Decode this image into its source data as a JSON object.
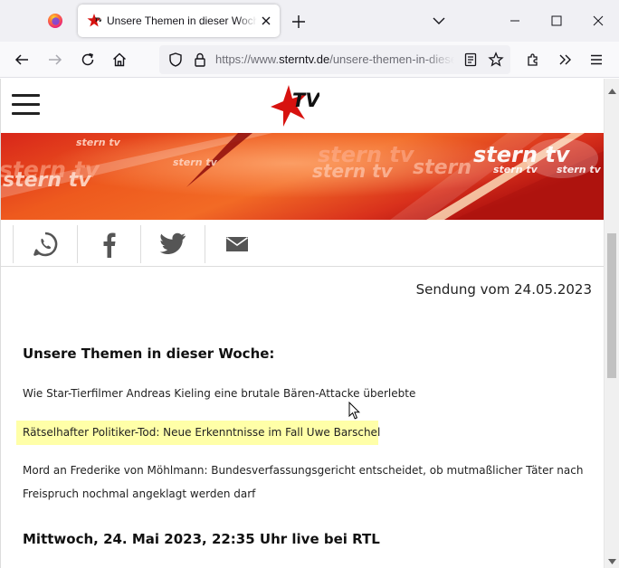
{
  "browser": {
    "tab": {
      "title": "Unsere Themen in dieser Woche"
    },
    "url": {
      "prefix": "https://www.",
      "domain": "sterntv.de",
      "path": "/unsere-themen-in-dieser-woche"
    },
    "icons": [
      "firefox-icon",
      "close-icon",
      "plus-icon",
      "chevron-down-icon",
      "minimize-icon",
      "maximize-icon",
      "window-close-icon",
      "back-icon",
      "forward-icon",
      "reload-icon",
      "home-icon",
      "shield-icon",
      "lock-icon",
      "reader-view-icon",
      "bookmark-star-icon",
      "extensions-icon",
      "overflow-icon",
      "menu-icon"
    ]
  },
  "site": {
    "logo_text": "TV",
    "banner_texts": [
      "stern tv",
      "stern tv",
      "stern tv",
      "stern tv",
      "stern tv",
      "stern tv",
      "stern",
      "stern tv",
      "stern tv",
      "stern tv"
    ],
    "share": [
      "whatsapp-icon",
      "facebook-icon",
      "twitter-icon",
      "email-icon"
    ],
    "brand_red": "#d7120f"
  },
  "article": {
    "broadcast_date": "Sendung vom 24.05.2023",
    "heading": "Unsere Themen in dieser Woche:",
    "topics": [
      "Wie Star-Tierfilmer Andreas Kieling eine brutale Bären-Attacke überlebte",
      "Rätselhafter Politiker-Tod: Neue Erkenntnisse im Fall Uwe Barschel",
      "Mord an Frederike von Möhlmann: Bundesverfassungsgericht entscheidet, ob mutmaßlicher Täter nach",
      "Freispruch nochmal angeklagt werden darf"
    ],
    "highlight_color": "#ffffa8",
    "airtime": "Mittwoch, 24. Mai 2023, 22:35 Uhr live bei RTL"
  }
}
